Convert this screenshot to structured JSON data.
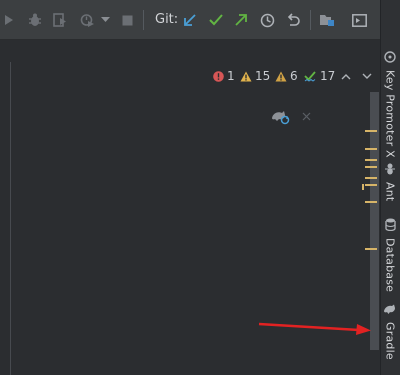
{
  "toolbar": {
    "git_label": "Git:",
    "icons": [
      "run-icon",
      "debug-icon",
      "coverage-icon",
      "profile-icon",
      "dropdown-icon",
      "stop-icon",
      "git-update-icon",
      "git-commit-icon",
      "git-push-icon",
      "history-icon",
      "rollback-icon",
      "project-structure-icon",
      "terminal-icon"
    ]
  },
  "inspections": {
    "errors": "1",
    "warnings": "15",
    "weak_warnings": "6",
    "typos": "17"
  },
  "side_tabs": {
    "key_promoter": "Key Promoter X",
    "ant": "Ant",
    "database": "Database",
    "gradle": "Gradle"
  },
  "colors": {
    "error": "#d65656",
    "warning": "#e0b24c",
    "commit_check": "#62b543",
    "update_arrow": "#4a9fd6",
    "annotation_arrow": "#e22222"
  }
}
